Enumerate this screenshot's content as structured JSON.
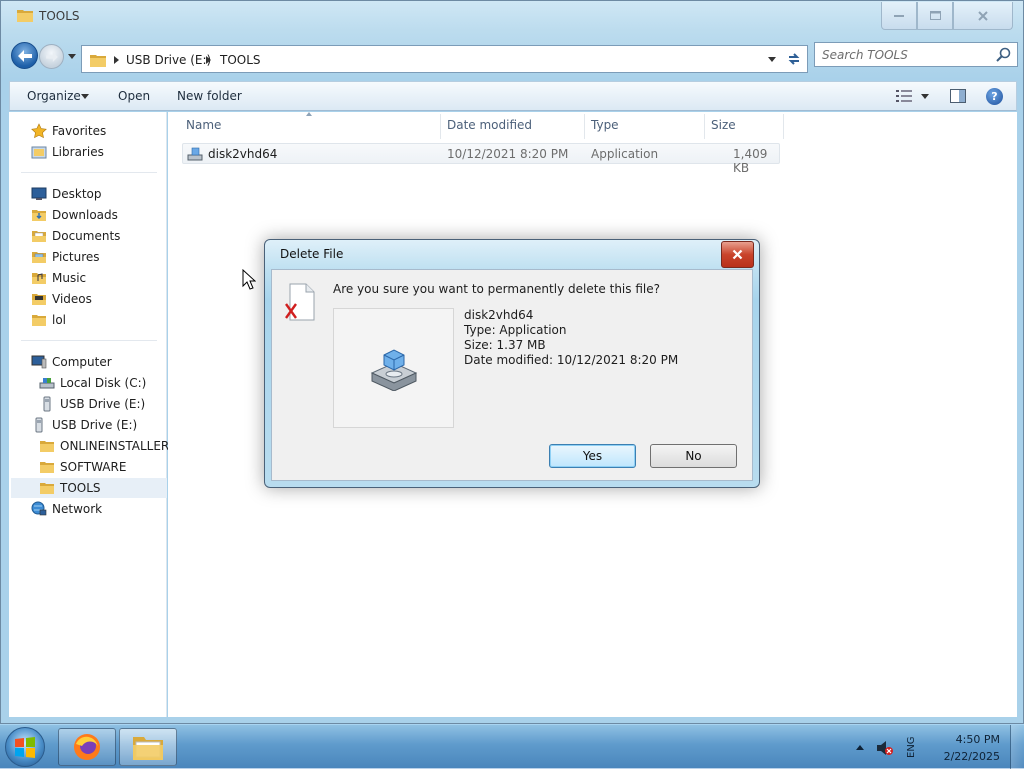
{
  "window": {
    "title": "TOOLS"
  },
  "address": {
    "crumbs": [
      "USB Drive (E:)",
      "TOOLS"
    ]
  },
  "search": {
    "placeholder": "Search TOOLS"
  },
  "commandbar": {
    "organize": "Organize",
    "open": "Open",
    "new_folder": "New folder"
  },
  "nav": {
    "favorites": "Favorites",
    "libraries": "Libraries",
    "desktop": "Desktop",
    "downloads": "Downloads",
    "documents": "Documents",
    "pictures": "Pictures",
    "music": "Music",
    "videos": "Videos",
    "lol": "lol",
    "computer": "Computer",
    "local_disk": "Local Disk (C:)",
    "usb_drive_sub": "USB Drive (E:)",
    "usb_drive": "USB Drive (E:)",
    "onlineinstallers": "ONLINEINSTALLERS",
    "software": "SOFTWARE",
    "tools": "TOOLS",
    "network": "Network"
  },
  "columns": {
    "name": "Name",
    "date_modified": "Date modified",
    "type": "Type",
    "size": "Size"
  },
  "files": [
    {
      "name": "disk2vhd64",
      "date": "10/12/2021 8:20 PM",
      "type": "Application",
      "size": "1,409 KB"
    }
  ],
  "dialog": {
    "title": "Delete File",
    "question": "Are you sure you want to permanently delete this file?",
    "file_name": "disk2vhd64",
    "file_type": "Type: Application",
    "file_size": "Size: 1.37 MB",
    "file_date": "Date modified: 10/12/2021 8:20 PM",
    "yes": "Yes",
    "no": "No"
  },
  "taskbar": {
    "language": "ENG",
    "time": "4:50 PM",
    "date": "2/22/2025"
  },
  "colors": {
    "accent": "#1d5fa8",
    "close_red": "#c9442b",
    "taskbar": "#5f9bcc"
  }
}
